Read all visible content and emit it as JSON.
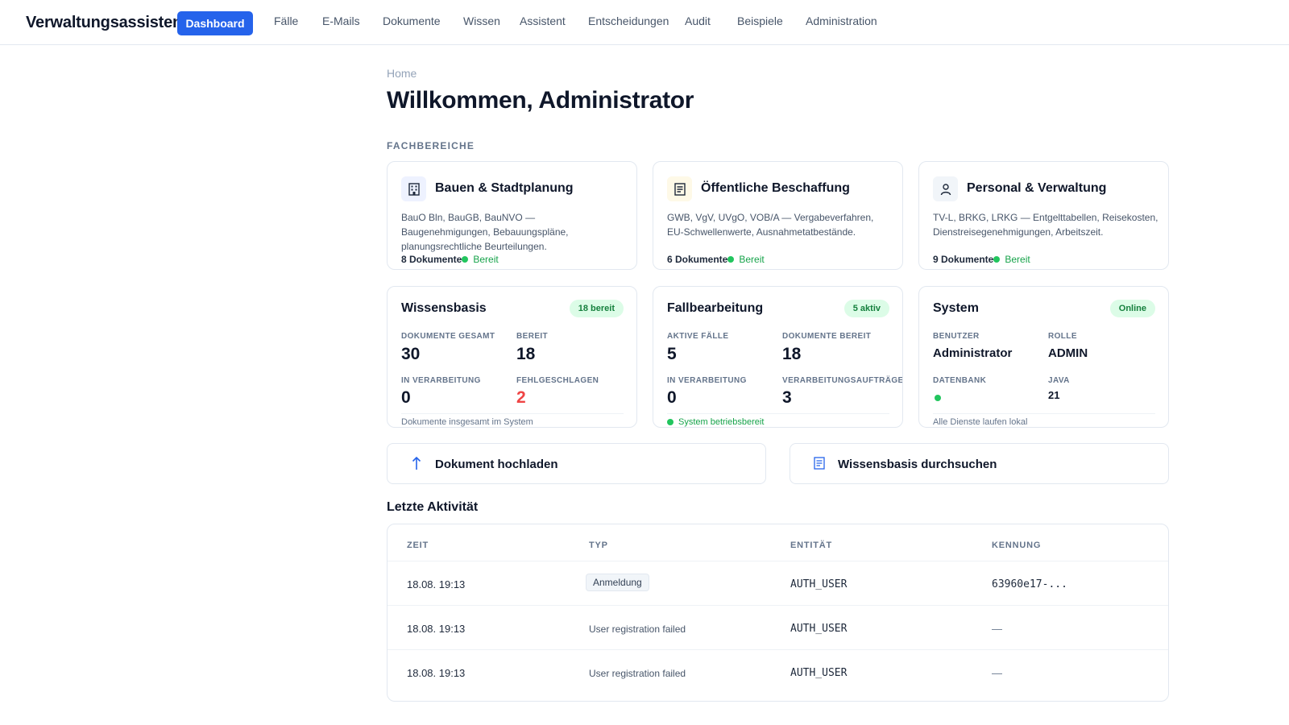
{
  "app": {
    "title": "Verwaltungsassistent"
  },
  "nav": {
    "active": "Dashboard",
    "items": [
      "Fälle",
      "E-Mails",
      "Dokumente",
      "Wissen",
      "Assistent",
      "Entscheidungen",
      "Audit",
      "Beispiele",
      "Administration"
    ]
  },
  "breadcrumb": "Home",
  "page_title": "Willkommen, Administrator",
  "section_label": "FACHBEREICHE",
  "areas": [
    {
      "icon": "building-icon",
      "title": "Bauen & Stadtplanung",
      "description": "BauO Bln, BauGB, BauNVO — Baugenehmigungen, Bebauungspläne, planungsrechtliche Beurteilungen.",
      "docs": "8 Dokumente",
      "status": "Bereit",
      "icon_bg": "#eef2ff"
    },
    {
      "icon": "procurement-icon",
      "title": "Öffentliche Beschaffung",
      "description": "GWB, VgV, UVgO, VOB/A — Vergabeverfahren, EU-Schwellenwerte, Ausnahmetatbestände.",
      "docs": "6 Dokumente",
      "status": "Bereit",
      "icon_bg": "#fef9e7"
    },
    {
      "icon": "personnel-icon",
      "title": "Personal & Verwaltung",
      "description": "TV-L, BRKG, LRKG — Entgelttabellen, Reisekosten, Dienstreisegenehmigungen, Arbeitszeit.",
      "docs": "9 Dokumente",
      "status": "Bereit",
      "icon_bg": "#f1f5f9"
    }
  ],
  "stats": {
    "knowledge": {
      "title": "Wissensbasis",
      "badge": "18 bereit",
      "items": [
        {
          "label": "DOKUMENTE GESAMT",
          "value": "30"
        },
        {
          "label": "BEREIT",
          "value": "18"
        },
        {
          "label": "IN VERARBEITUNG",
          "value": "0"
        },
        {
          "label": "FEHLGESCHLAGEN",
          "value": "2"
        }
      ],
      "note": "Dokumente insgesamt im System"
    },
    "cases": {
      "title": "Fallbearbeitung",
      "badge": "5 aktiv",
      "items": [
        {
          "label": "AKTIVE FÄLLE",
          "value": "5"
        },
        {
          "label": "DOKUMENTE BEREIT",
          "value": "18"
        },
        {
          "label": "IN VERARBEITUNG",
          "value": "0"
        },
        {
          "label": "VERARBEITUNGSAUFTRÄGE",
          "value": "3"
        }
      ],
      "note": "System betriebsbereit"
    },
    "system": {
      "title": "System",
      "badge": "Online",
      "items": [
        {
          "label": "BENUTZER",
          "value": "Administrator"
        },
        {
          "label": "ROLLE",
          "value": "ADMIN"
        },
        {
          "label": "DATENBANK",
          "value": ""
        },
        {
          "label": "JAVA",
          "value": "21"
        }
      ],
      "note": "Alle Dienste laufen lokal"
    }
  },
  "actions": {
    "upload": {
      "label": "Dokument hochladen",
      "icon": "upload-arrow-icon"
    },
    "search": {
      "label": "Wissensbasis durchsuchen",
      "icon": "search-icon"
    }
  },
  "activity": {
    "title": "Letzte Aktivität",
    "columns": [
      "ZEIT",
      "TYP",
      "ENTITÄT",
      "KENNUNG"
    ],
    "rows": [
      {
        "time": "18.08. 19:13",
        "type": "Anmeldung",
        "entity": "AUTH_USER",
        "id": "63960e17-..."
      },
      {
        "time": "18.08. 19:13",
        "type": "User registration failed",
        "entity": "AUTH_USER",
        "id": "—"
      },
      {
        "time": "18.08. 19:13",
        "type": "User registration failed",
        "entity": "AUTH_USER",
        "id": "—"
      }
    ]
  },
  "colors": {
    "accent": "#2563eb",
    "success": "#16a34a",
    "danger": "#ef4444"
  }
}
